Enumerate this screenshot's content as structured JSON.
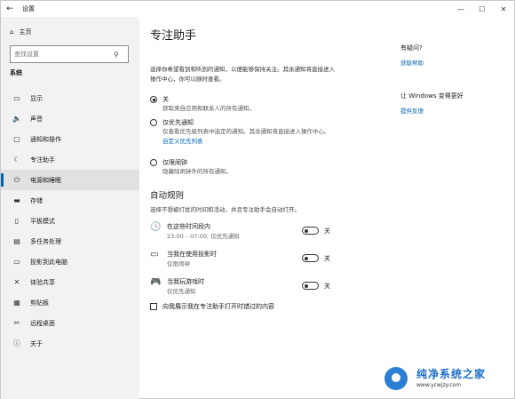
{
  "window": {
    "title": "设置",
    "back": "←",
    "minimize": "—",
    "maximize": "☐",
    "close": "✕"
  },
  "sidebar": {
    "home": "主页",
    "search_placeholder": "查找设置",
    "section": "系统",
    "items": [
      {
        "label": "显示",
        "icon": "▭"
      },
      {
        "label": "声音",
        "icon": "🔈"
      },
      {
        "label": "通知和操作",
        "icon": "▢"
      },
      {
        "label": "专注助手",
        "icon": "☾"
      },
      {
        "label": "电源和睡眠",
        "icon": "⏻"
      },
      {
        "label": "存储",
        "icon": "▬"
      },
      {
        "label": "平板模式",
        "icon": "▯"
      },
      {
        "label": "多任务处理",
        "icon": "▤"
      },
      {
        "label": "投影到此电脑",
        "icon": "▭"
      },
      {
        "label": "体验共享",
        "icon": "✕"
      },
      {
        "label": "剪贴板",
        "icon": "▦"
      },
      {
        "label": "远程桌面",
        "icon": "✂"
      },
      {
        "label": "关于",
        "icon": "ⓘ"
      }
    ]
  },
  "main": {
    "title": "专注助手",
    "intro": "选择你希望看到和听到的通知，以便能够保持关注。其余通知将直接进入操作中心，你可以随时查看。",
    "options": [
      {
        "label": "关",
        "desc": "获取来自应用和联系人的所有通知。",
        "checked": true
      },
      {
        "label": "仅优先通知",
        "desc": "仅查看优先级列表中选定的通知。其余通知将直接进入操作中心。",
        "link": "自定义优先列表",
        "checked": false
      },
      {
        "label": "仅限闹钟",
        "desc": "隐藏除闹钟外的所有通知。",
        "checked": false
      }
    ],
    "auto_heading": "自动规则",
    "auto_desc": "选择不想被打扰的时间和活动，并且专注助手会自动打开。",
    "rules": [
      {
        "title": "在这些时间段内",
        "sub": "23:00 – 07:00; 仅优先通知",
        "state": "关",
        "icon": "🕓"
      },
      {
        "title": "当我在使用投影时",
        "sub": "仅限闹钟",
        "state": "关",
        "icon": "▭"
      },
      {
        "title": "当我玩游戏时",
        "sub": "仅优先通知",
        "state": "关",
        "icon": "🎮"
      }
    ],
    "checkbox_label": "向我展示我在专注助手打开时错过的内容"
  },
  "right": {
    "q_title": "有疑问?",
    "q_link": "获取帮助",
    "fb_title": "让 Windows 变得更好",
    "fb_link": "提供反馈"
  },
  "watermark": {
    "name": "纯净系统之家",
    "url": "www.ycwjzy.com"
  }
}
